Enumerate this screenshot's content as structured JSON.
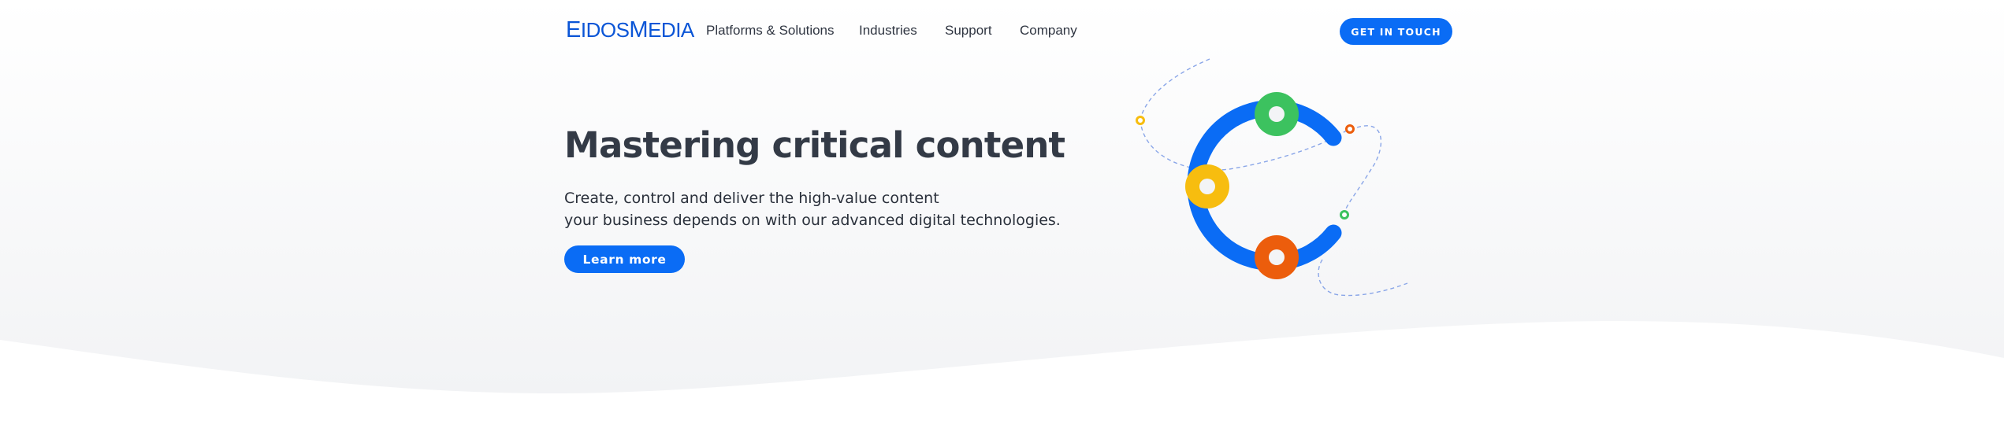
{
  "brand": {
    "logo_text": "EIDOSMEDIA",
    "color": "#0a55d6"
  },
  "nav": {
    "items": [
      {
        "label": "Platforms & Solutions"
      },
      {
        "label": "Industries"
      },
      {
        "label": "Support"
      },
      {
        "label": "Company"
      }
    ],
    "cta_label": "GET IN TOUCH"
  },
  "hero": {
    "title": "Mastering critical content",
    "subtitle_line1": "Create, control and deliver the high-value content",
    "subtitle_line2": "your business depends on with our advanced digital technologies.",
    "button_label": "Learn more"
  },
  "colors": {
    "accent": "#0a6cf5",
    "ring_blue": "#0a6cf5",
    "node_green": "#3cc25f",
    "node_yellow": "#f7bd0f",
    "node_orange": "#ec5d0c",
    "background_top": "#ffffff",
    "background_bottom": "#f2f3f5"
  },
  "illustration": {
    "icon": "content-cycle-icon"
  }
}
